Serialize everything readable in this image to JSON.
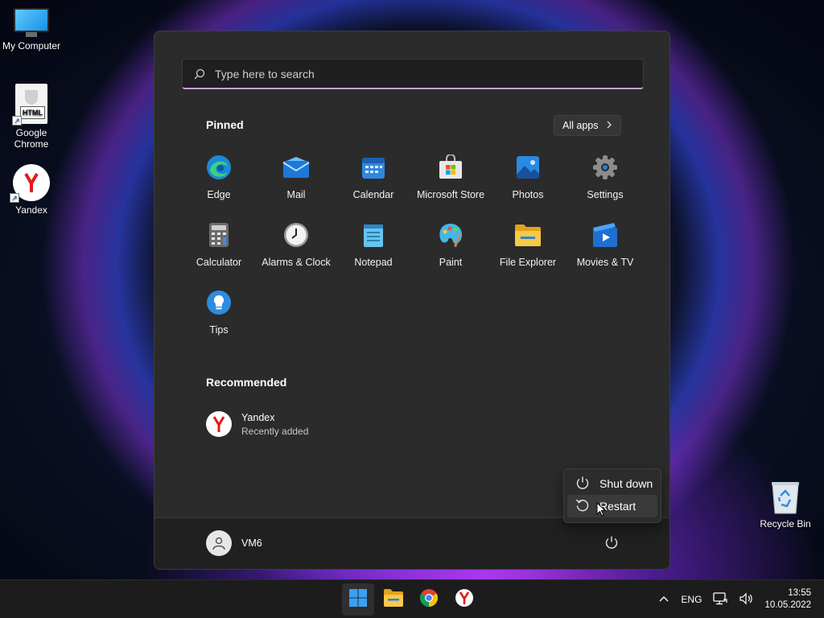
{
  "desktop": {
    "icons": [
      {
        "label": "My Computer",
        "icon": "monitor-icon"
      },
      {
        "label": "Google Chrome",
        "icon": "html-file-icon"
      },
      {
        "label": "Yandex",
        "icon": "yandex-icon"
      }
    ],
    "recycle_bin": {
      "label": "Recycle Bin",
      "icon": "recycle-bin-icon"
    }
  },
  "start_menu": {
    "search": {
      "placeholder": "Type here to search",
      "icon": "search-icon"
    },
    "pinned": {
      "title": "Pinned",
      "all_apps_label": "All apps",
      "apps": [
        {
          "label": "Edge",
          "icon": "edge-icon"
        },
        {
          "label": "Mail",
          "icon": "mail-icon"
        },
        {
          "label": "Calendar",
          "icon": "calendar-icon"
        },
        {
          "label": "Microsoft Store",
          "icon": "store-icon"
        },
        {
          "label": "Photos",
          "icon": "photos-icon"
        },
        {
          "label": "Settings",
          "icon": "gear-icon"
        },
        {
          "label": "Calculator",
          "icon": "calculator-icon"
        },
        {
          "label": "Alarms & Clock",
          "icon": "clock-icon"
        },
        {
          "label": "Notepad",
          "icon": "notepad-icon"
        },
        {
          "label": "Paint",
          "icon": "paint-icon"
        },
        {
          "label": "File Explorer",
          "icon": "folder-icon"
        },
        {
          "label": "Movies & TV",
          "icon": "movies-icon"
        },
        {
          "label": "Tips",
          "icon": "lightbulb-icon"
        }
      ]
    },
    "recommended": {
      "title": "Recommended",
      "items": [
        {
          "title": "Yandex",
          "subtitle": "Recently added",
          "icon": "yandex-icon"
        }
      ]
    },
    "user": {
      "name": "VM6",
      "icon": "user-icon"
    },
    "power_menu": {
      "items": [
        {
          "label": "Shut down",
          "icon": "power-icon"
        },
        {
          "label": "Restart",
          "icon": "restart-icon"
        }
      ]
    }
  },
  "taskbar": {
    "apps": [
      "start-icon",
      "folder-icon",
      "chrome-icon",
      "yandex-icon"
    ],
    "tray": {
      "language": "ENG",
      "time": "13:55",
      "date": "10.05.2022"
    }
  },
  "colors": {
    "accent": "#c79fd6",
    "start_bg": "#2b2b2b",
    "taskbar_bg": "#1c1c1c"
  }
}
